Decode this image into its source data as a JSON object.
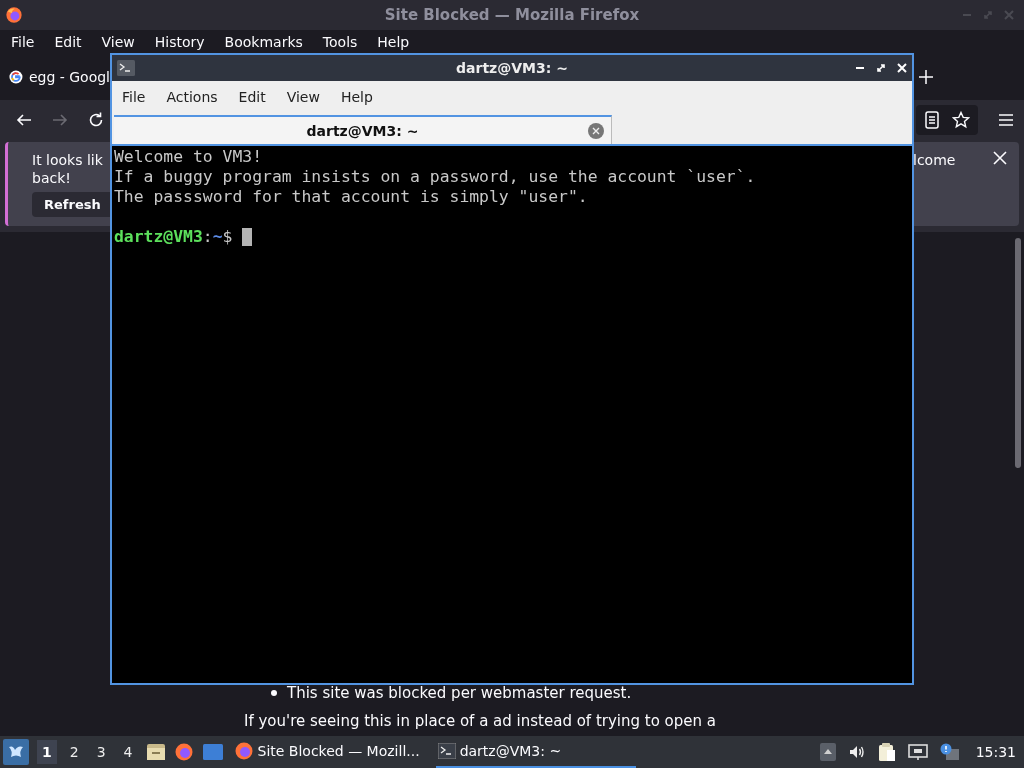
{
  "firefox": {
    "title": "Site Blocked — Mozilla Firefox",
    "menu": [
      "File",
      "Edit",
      "View",
      "History",
      "Bookmarks",
      "Tools",
      "Help"
    ],
    "tab": {
      "title": "egg - Googl"
    },
    "nav_buttons": [
      {
        "kind": "back",
        "disabled": false
      },
      {
        "kind": "forward",
        "disabled": true
      },
      {
        "kind": "reload",
        "disabled": false
      }
    ],
    "notification": {
      "lines": [
        "It looks lik",
        "back!"
      ],
      "right_text": "lcome",
      "button": "Refresh"
    },
    "page": {
      "bullet": "This site was blocked per webmaster request.",
      "paragraph": "If you're seeing this in place of a ad instead of trying to open a"
    }
  },
  "terminal": {
    "title": "dartz@VM3: ~",
    "menu": [
      "File",
      "Actions",
      "Edit",
      "View",
      "Help"
    ],
    "tab": "dartz@VM3: ~",
    "lines": [
      "Welcome to VM3!",
      "If a buggy program insists on a password, use the account `user`.",
      "The passsword for that account is simply \"user\"."
    ],
    "prompt": {
      "user_host": "dartz@VM3",
      "separator": ":",
      "path": "~",
      "symbol": "$"
    }
  },
  "taskbar": {
    "workspaces": [
      {
        "label": "1",
        "selected": true
      },
      {
        "label": "2",
        "selected": false
      },
      {
        "label": "3",
        "selected": false
      },
      {
        "label": "4",
        "selected": false
      }
    ],
    "tasks": [
      {
        "kind": "browser",
        "title": "Site Blocked — Mozill...",
        "selected": false
      },
      {
        "kind": "terminal",
        "title": "dartz@VM3: ~",
        "selected": true
      }
    ],
    "clock": "15:31"
  }
}
